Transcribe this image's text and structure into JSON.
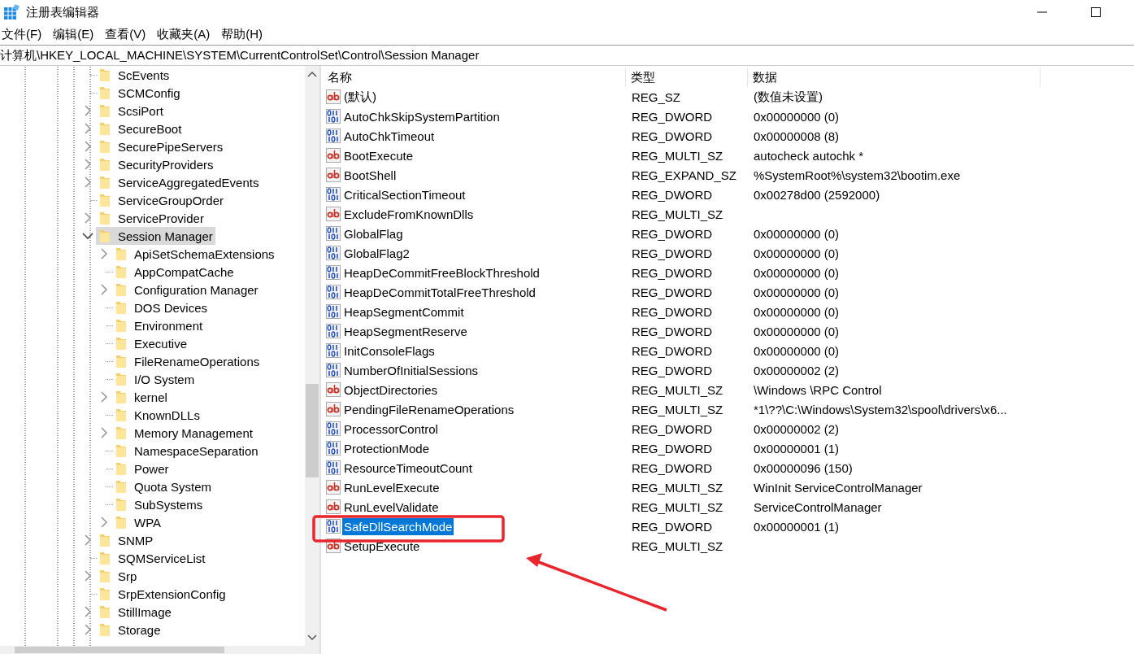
{
  "window": {
    "title": "注册表编辑器"
  },
  "menu": [
    "文件(F)",
    "编辑(E)",
    "查看(V)",
    "收藏夹(A)",
    "帮助(H)"
  ],
  "address": "计算机\\HKEY_LOCAL_MACHINE\\SYSTEM\\CurrentControlSet\\Control\\Session Manager",
  "tree": [
    {
      "label": "ScEvents",
      "expandable": false,
      "expanded": false,
      "selected": false
    },
    {
      "label": "SCMConfig",
      "expandable": false,
      "expanded": false,
      "selected": false
    },
    {
      "label": "ScsiPort",
      "expandable": true,
      "expanded": false,
      "selected": false
    },
    {
      "label": "SecureBoot",
      "expandable": true,
      "expanded": false,
      "selected": false
    },
    {
      "label": "SecurePipeServers",
      "expandable": true,
      "expanded": false,
      "selected": false
    },
    {
      "label": "SecurityProviders",
      "expandable": true,
      "expanded": false,
      "selected": false
    },
    {
      "label": "ServiceAggregatedEvents",
      "expandable": true,
      "expanded": false,
      "selected": false
    },
    {
      "label": "ServiceGroupOrder",
      "expandable": false,
      "expanded": false,
      "selected": false
    },
    {
      "label": "ServiceProvider",
      "expandable": true,
      "expanded": false,
      "selected": false
    },
    {
      "label": "Session Manager",
      "expandable": true,
      "expanded": true,
      "selected": true,
      "children": [
        {
          "label": "ApiSetSchemaExtensions",
          "expandable": true,
          "expanded": false,
          "selected": false
        },
        {
          "label": "AppCompatCache",
          "expandable": false,
          "expanded": false,
          "selected": false
        },
        {
          "label": "Configuration Manager",
          "expandable": true,
          "expanded": false,
          "selected": false
        },
        {
          "label": "DOS Devices",
          "expandable": false,
          "expanded": false,
          "selected": false
        },
        {
          "label": "Environment",
          "expandable": false,
          "expanded": false,
          "selected": false
        },
        {
          "label": "Executive",
          "expandable": false,
          "expanded": false,
          "selected": false
        },
        {
          "label": "FileRenameOperations",
          "expandable": false,
          "expanded": false,
          "selected": false
        },
        {
          "label": "I/O System",
          "expandable": false,
          "expanded": false,
          "selected": false
        },
        {
          "label": "kernel",
          "expandable": true,
          "expanded": false,
          "selected": false
        },
        {
          "label": "KnownDLLs",
          "expandable": false,
          "expanded": false,
          "selected": false
        },
        {
          "label": "Memory Management",
          "expandable": true,
          "expanded": false,
          "selected": false
        },
        {
          "label": "NamespaceSeparation",
          "expandable": false,
          "expanded": false,
          "selected": false
        },
        {
          "label": "Power",
          "expandable": false,
          "expanded": false,
          "selected": false
        },
        {
          "label": "Quota System",
          "expandable": false,
          "expanded": false,
          "selected": false
        },
        {
          "label": "SubSystems",
          "expandable": false,
          "expanded": false,
          "selected": false
        },
        {
          "label": "WPA",
          "expandable": true,
          "expanded": false,
          "selected": false
        }
      ]
    },
    {
      "label": "SNMP",
      "expandable": true,
      "expanded": false,
      "selected": false
    },
    {
      "label": "SQMServiceList",
      "expandable": false,
      "expanded": false,
      "selected": false
    },
    {
      "label": "Srp",
      "expandable": true,
      "expanded": false,
      "selected": false
    },
    {
      "label": "SrpExtensionConfig",
      "expandable": false,
      "expanded": false,
      "selected": false
    },
    {
      "label": "StillImage",
      "expandable": true,
      "expanded": false,
      "selected": false
    },
    {
      "label": "Storage",
      "expandable": true,
      "expanded": false,
      "selected": false
    }
  ],
  "table": {
    "columns": [
      "名称",
      "类型",
      "数据"
    ],
    "rows": [
      {
        "kind": "string",
        "name": "(默认)",
        "type": "REG_SZ",
        "data": "(数值未设置)",
        "selected": false
      },
      {
        "kind": "binary",
        "name": "AutoChkSkipSystemPartition",
        "type": "REG_DWORD",
        "data": "0x00000000 (0)",
        "selected": false
      },
      {
        "kind": "binary",
        "name": "AutoChkTimeout",
        "type": "REG_DWORD",
        "data": "0x00000008 (8)",
        "selected": false
      },
      {
        "kind": "string",
        "name": "BootExecute",
        "type": "REG_MULTI_SZ",
        "data": "autocheck autochk *",
        "selected": false
      },
      {
        "kind": "string",
        "name": "BootShell",
        "type": "REG_EXPAND_SZ",
        "data": "%SystemRoot%\\system32\\bootim.exe",
        "selected": false
      },
      {
        "kind": "binary",
        "name": "CriticalSectionTimeout",
        "type": "REG_DWORD",
        "data": "0x00278d00 (2592000)",
        "selected": false
      },
      {
        "kind": "string",
        "name": "ExcludeFromKnownDlls",
        "type": "REG_MULTI_SZ",
        "selected": false
      },
      {
        "kind": "binary",
        "name": "GlobalFlag",
        "type": "REG_DWORD",
        "data": "0x00000000 (0)",
        "selected": false
      },
      {
        "kind": "binary",
        "name": "GlobalFlag2",
        "type": "REG_DWORD",
        "data": "0x00000000 (0)",
        "selected": false
      },
      {
        "kind": "binary",
        "name": "HeapDeCommitFreeBlockThreshold",
        "type": "REG_DWORD",
        "data": "0x00000000 (0)",
        "selected": false
      },
      {
        "kind": "binary",
        "name": "HeapDeCommitTotalFreeThreshold",
        "type": "REG_DWORD",
        "data": "0x00000000 (0)",
        "selected": false
      },
      {
        "kind": "binary",
        "name": "HeapSegmentCommit",
        "type": "REG_DWORD",
        "data": "0x00000000 (0)",
        "selected": false
      },
      {
        "kind": "binary",
        "name": "HeapSegmentReserve",
        "type": "REG_DWORD",
        "data": "0x00000000 (0)",
        "selected": false
      },
      {
        "kind": "binary",
        "name": "InitConsoleFlags",
        "type": "REG_DWORD",
        "data": "0x00000000 (0)",
        "selected": false
      },
      {
        "kind": "binary",
        "name": "NumberOfInitialSessions",
        "type": "REG_DWORD",
        "data": "0x00000002 (2)",
        "selected": false
      },
      {
        "kind": "string",
        "name": "ObjectDirectories",
        "type": "REG_MULTI_SZ",
        "data": "\\Windows \\RPC Control",
        "selected": false
      },
      {
        "kind": "string",
        "name": "PendingFileRenameOperations",
        "type": "REG_MULTI_SZ",
        "data": "*1\\??\\C:\\Windows\\System32\\spool\\drivers\\x6...",
        "selected": false
      },
      {
        "kind": "binary",
        "name": "ProcessorControl",
        "type": "REG_DWORD",
        "data": "0x00000002 (2)",
        "selected": false
      },
      {
        "kind": "binary",
        "name": "ProtectionMode",
        "type": "REG_DWORD",
        "data": "0x00000001 (1)",
        "selected": false
      },
      {
        "kind": "binary",
        "name": "ResourceTimeoutCount",
        "type": "REG_DWORD",
        "data": "0x00000096 (150)",
        "selected": false
      },
      {
        "kind": "string",
        "name": "RunLevelExecute",
        "type": "REG_MULTI_SZ",
        "data": "WinInit ServiceControlManager",
        "selected": false
      },
      {
        "kind": "string",
        "name": "RunLevelValidate",
        "type": "REG_MULTI_SZ",
        "data": "ServiceControlManager",
        "selected": false
      },
      {
        "kind": "binary",
        "name": "SafeDllSearchMode",
        "type": "REG_DWORD",
        "data": "0x00000001 (1)",
        "selected": true
      },
      {
        "kind": "string",
        "name": "SetupExecute",
        "type": "REG_MULTI_SZ",
        "selected": false
      }
    ]
  }
}
